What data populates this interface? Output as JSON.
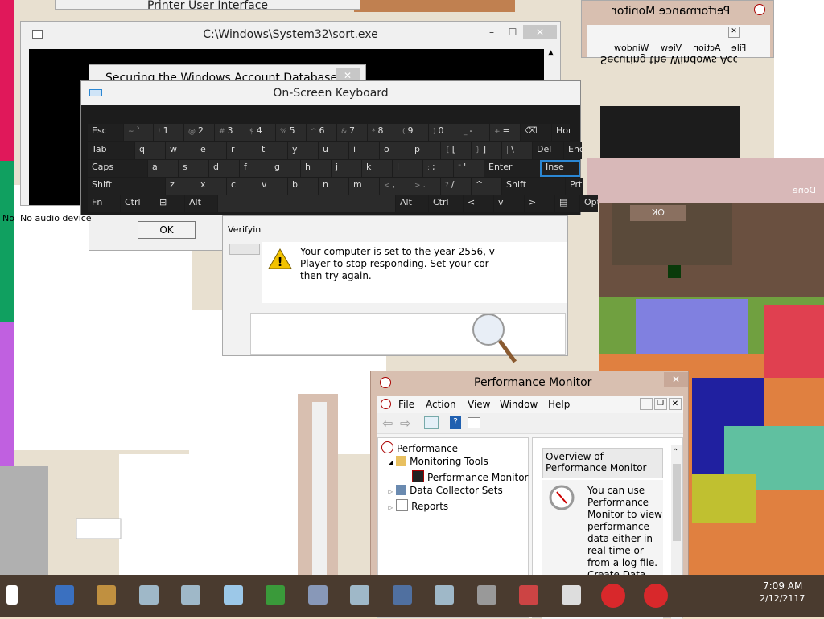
{
  "colors": {
    "accent": "#2b87d3",
    "error": "#d8282b",
    "warning": "#f2c200",
    "osk_bg": "#1c1c1c",
    "pm_title": "#d8bfb0",
    "taskbar": "#4a3b2f"
  },
  "bg_windows": {
    "printer_title": "Printer User Interface",
    "sort_title": "C:\\Windows\\System32\\sort.exe",
    "securing_title": "Securing the Windows Account Database",
    "securing_dup": "Securing the Windows Account D",
    "ok_label": "OK",
    "no_audio": "No audio device",
    "no_audio_clip": "No",
    "verifying": "Verifyin",
    "done": "Done",
    "ok_mirror": "OK",
    "year_msg": "Your computer is set to the year 2556, which may cause Windows Media Player to stop responding. Set your computer's clock to the correct date and then try again.",
    "year_msg_lines": [
      "Your computer is set to the year 2556, v",
      "Player to stop responding. Set your cor",
      "then try again."
    ]
  },
  "pm_mirror": {
    "title": "Performance Monitor",
    "menu": [
      "File",
      "Action",
      "View",
      "Window"
    ],
    "clip_titles": [
      "tor",
      "Ho",
      "He",
      "A"
    ]
  },
  "osk": {
    "title": "On-Screen Keyboard",
    "rows": [
      [
        {
          "t": "Esc",
          "w": 44,
          "fn": true
        },
        {
          "s": "~",
          "t": "`",
          "w": 36
        },
        {
          "s": "!",
          "t": "1",
          "w": 37
        },
        {
          "s": "@",
          "t": "2",
          "w": 37
        },
        {
          "s": "#",
          "t": "3",
          "w": 37
        },
        {
          "s": "$",
          "t": "4",
          "w": 37
        },
        {
          "s": "%",
          "t": "5",
          "w": 37
        },
        {
          "s": "^",
          "t": "6",
          "w": 37
        },
        {
          "s": "&",
          "t": "7",
          "w": 37
        },
        {
          "s": "*",
          "t": "8",
          "w": 37
        },
        {
          "s": "(",
          "t": "9",
          "w": 37
        },
        {
          "s": ")",
          "t": "0",
          "w": 37
        },
        {
          "s": "_",
          "t": "-",
          "w": 37
        },
        {
          "s": "+",
          "t": "=",
          "w": 37
        },
        {
          "t": "⌫",
          "w": 38,
          "fn": true
        },
        {
          "t": "Hor",
          "w": 22,
          "fn": true
        }
      ],
      [
        {
          "t": "Tab",
          "w": 58,
          "fn": true
        },
        {
          "t": "q",
          "w": 37
        },
        {
          "t": "w",
          "w": 37
        },
        {
          "t": "e",
          "w": 37
        },
        {
          "t": "r",
          "w": 37
        },
        {
          "t": "t",
          "w": 37
        },
        {
          "t": "y",
          "w": 37
        },
        {
          "t": "u",
          "w": 37
        },
        {
          "t": "i",
          "w": 37
        },
        {
          "t": "o",
          "w": 37
        },
        {
          "t": "p",
          "w": 37
        },
        {
          "s": "{",
          "t": "[",
          "w": 37
        },
        {
          "s": "}",
          "t": "]",
          "w": 37
        },
        {
          "s": "|",
          "t": "\\",
          "w": 37
        },
        {
          "t": "Del",
          "w": 38,
          "fn": true
        },
        {
          "t": "End",
          "w": 22,
          "fn": true
        }
      ],
      [
        {
          "t": "Caps",
          "w": 74,
          "fn": true
        },
        {
          "t": "a",
          "w": 37
        },
        {
          "t": "s",
          "w": 37
        },
        {
          "t": "d",
          "w": 37
        },
        {
          "t": "f",
          "w": 37
        },
        {
          "t": "g",
          "w": 37
        },
        {
          "t": "h",
          "w": 37
        },
        {
          "t": "j",
          "w": 37
        },
        {
          "t": "k",
          "w": 37
        },
        {
          "t": "l",
          "w": 37
        },
        {
          "s": ":",
          "t": ";",
          "w": 37
        },
        {
          "s": "\"",
          "t": "'",
          "w": 37
        },
        {
          "t": "Enter",
          "w": 70,
          "fn": true
        },
        {
          "t": "Inse",
          "w": 46,
          "fn": true
        }
      ],
      [
        {
          "t": "Shift",
          "w": 96,
          "fn": true
        },
        {
          "t": "z",
          "w": 37
        },
        {
          "t": "x",
          "w": 37
        },
        {
          "t": "c",
          "w": 37
        },
        {
          "t": "v",
          "w": 37
        },
        {
          "t": "b",
          "w": 37
        },
        {
          "t": "n",
          "w": 37
        },
        {
          "t": "m",
          "w": 37
        },
        {
          "s": "<",
          "t": ",",
          "w": 37
        },
        {
          "s": ">",
          "t": ".",
          "w": 37
        },
        {
          "s": "?",
          "t": "/",
          "w": 37
        },
        {
          "t": "^",
          "w": 37
        },
        {
          "t": "Shift",
          "w": 78,
          "fn": true
        },
        {
          "t": "PrtS",
          "w": 22,
          "fn": true
        }
      ],
      [
        {
          "t": "Fn",
          "w": 40,
          "fn": true
        },
        {
          "t": "Ctrl",
          "w": 42,
          "fn": true
        },
        {
          "t": "⊞",
          "w": 36,
          "fn": true
        },
        {
          "t": "Alt",
          "w": 40,
          "fn": true
        },
        {
          "t": "",
          "w": 220
        },
        {
          "t": "Alt",
          "w": 40,
          "fn": true
        },
        {
          "t": "Ctrl",
          "w": 42,
          "fn": true
        },
        {
          "t": "<",
          "w": 37,
          "fn": true
        },
        {
          "t": "v",
          "w": 37,
          "fn": true
        },
        {
          "t": ">",
          "w": 37,
          "fn": true
        },
        {
          "t": "▤",
          "w": 30,
          "fn": true
        },
        {
          "t": "Opti",
          "w": 22,
          "fn": true
        }
      ]
    ],
    "side_keys": [
      "3",
      "e",
      "b"
    ]
  },
  "perfmon": {
    "title": "Performance Monitor",
    "menu": [
      "File",
      "Action",
      "View",
      "Window",
      "Help"
    ],
    "tree": {
      "root": "Performance",
      "monitoring_tools": "Monitoring Tools",
      "perf_monitor": "Performance Monitor",
      "data_collector": "Data Collector Sets",
      "reports": "Reports"
    },
    "overview_title": "Overview of Performance Monitor",
    "overview_text": [
      "You can use",
      "Performance",
      "Monitor to view",
      "performance",
      "data either in",
      "real time or",
      "from a log file.",
      "Create Data"
    ]
  },
  "taskbar": {
    "icons": [
      "start-icon",
      "messenger-icon",
      "users-icon",
      "window-icon",
      "window-icon",
      "sketch-icon",
      "network-icon",
      "control-panel-icon",
      "window-icon",
      "monitor-icon",
      "window-icon",
      "printer-icon",
      "recorder-icon",
      "perfmon-icon",
      "error-icon",
      "error-icon"
    ],
    "time": "7:09 AM",
    "date": "2/12/2117"
  }
}
